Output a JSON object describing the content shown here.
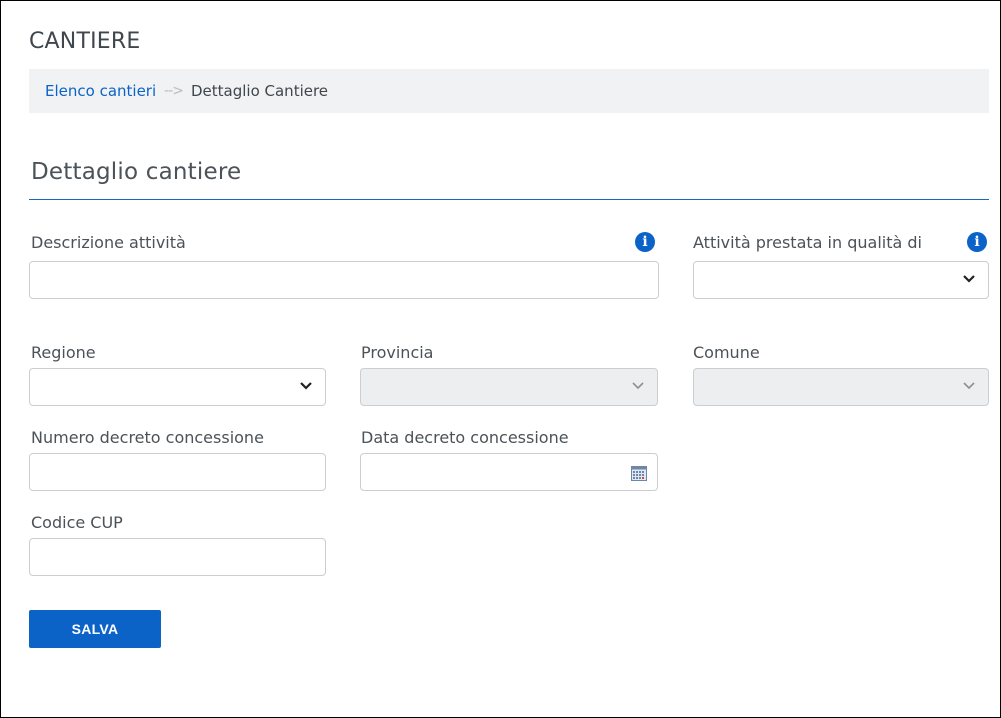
{
  "page": {
    "title": "CANTIERE"
  },
  "breadcrumb": {
    "link": "Elenco cantieri",
    "separator": "-->",
    "current": "Dettaglio Cantiere"
  },
  "section": {
    "title": "Dettaglio cantiere"
  },
  "form": {
    "descrizione": {
      "label": "Descrizione attività",
      "value": ""
    },
    "qualita": {
      "label": "Attività prestata in qualità di",
      "value": ""
    },
    "regione": {
      "label": "Regione",
      "value": ""
    },
    "provincia": {
      "label": "Provincia",
      "value": ""
    },
    "comune": {
      "label": "Comune",
      "value": ""
    },
    "numero_decreto": {
      "label": "Numero decreto concessione",
      "value": ""
    },
    "data_decreto": {
      "label": "Data decreto concessione",
      "value": ""
    },
    "cup": {
      "label": "Codice CUP",
      "value": ""
    }
  },
  "actions": {
    "save_label": "SALVA"
  },
  "icons": {
    "info": "info-icon",
    "chevron": "chevron-down-icon",
    "calendar": "calendar-icon"
  },
  "colors": {
    "accent": "#0b63c8",
    "disabled_bg": "#eceef0",
    "breadcrumb_bg": "#f1f2f4"
  }
}
